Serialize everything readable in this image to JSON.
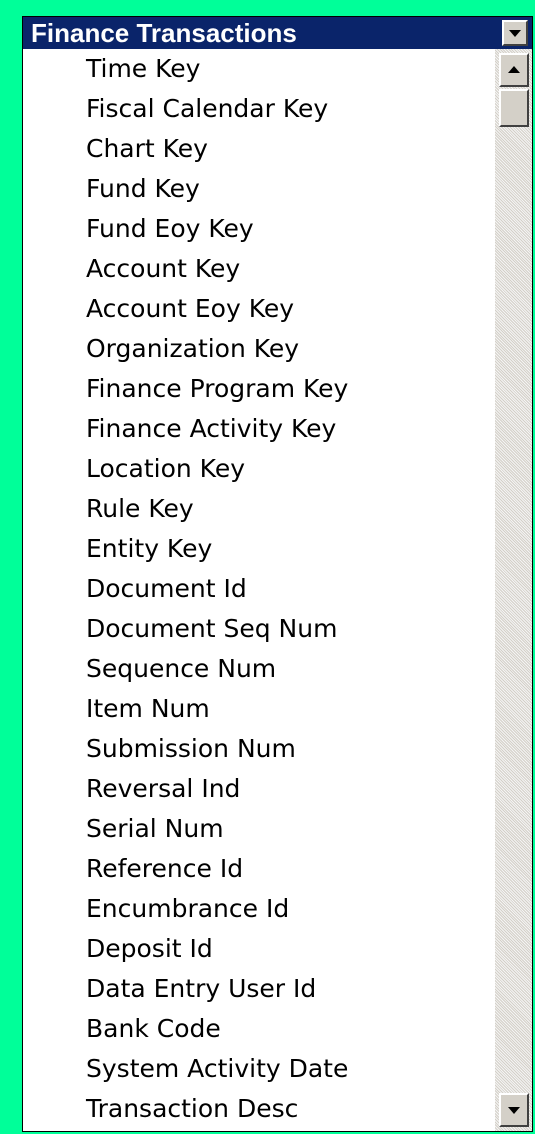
{
  "window": {
    "title": "Finance Transactions",
    "dropdown_icon": "chevron-down-icon"
  },
  "fields": [
    "Time Key",
    "Fiscal Calendar Key",
    "Chart Key",
    "Fund Key",
    "Fund Eoy Key",
    "Account Key",
    "Account Eoy Key",
    "Organization Key",
    "Finance Program Key",
    "Finance Activity Key",
    "Location Key",
    "Rule Key",
    "Entity Key",
    "Document Id",
    "Document Seq Num",
    "Sequence Num",
    "Item Num",
    "Submission Num",
    "Reversal Ind",
    "Serial Num",
    "Reference Id",
    "Encumbrance Id",
    "Deposit Id",
    "Data Entry User Id",
    "Bank Code",
    "System Activity Date",
    "Transaction Desc"
  ],
  "scrollbar": {
    "up_icon": "scroll-up-arrow-icon",
    "down_icon": "scroll-down-arrow-icon",
    "position": 0.0
  },
  "colors": {
    "background": "#00ff99",
    "titlebar": "#0a246a",
    "title_text": "#ffffff",
    "list_background": "#ffffff",
    "button_face": "#d4d0c8"
  }
}
